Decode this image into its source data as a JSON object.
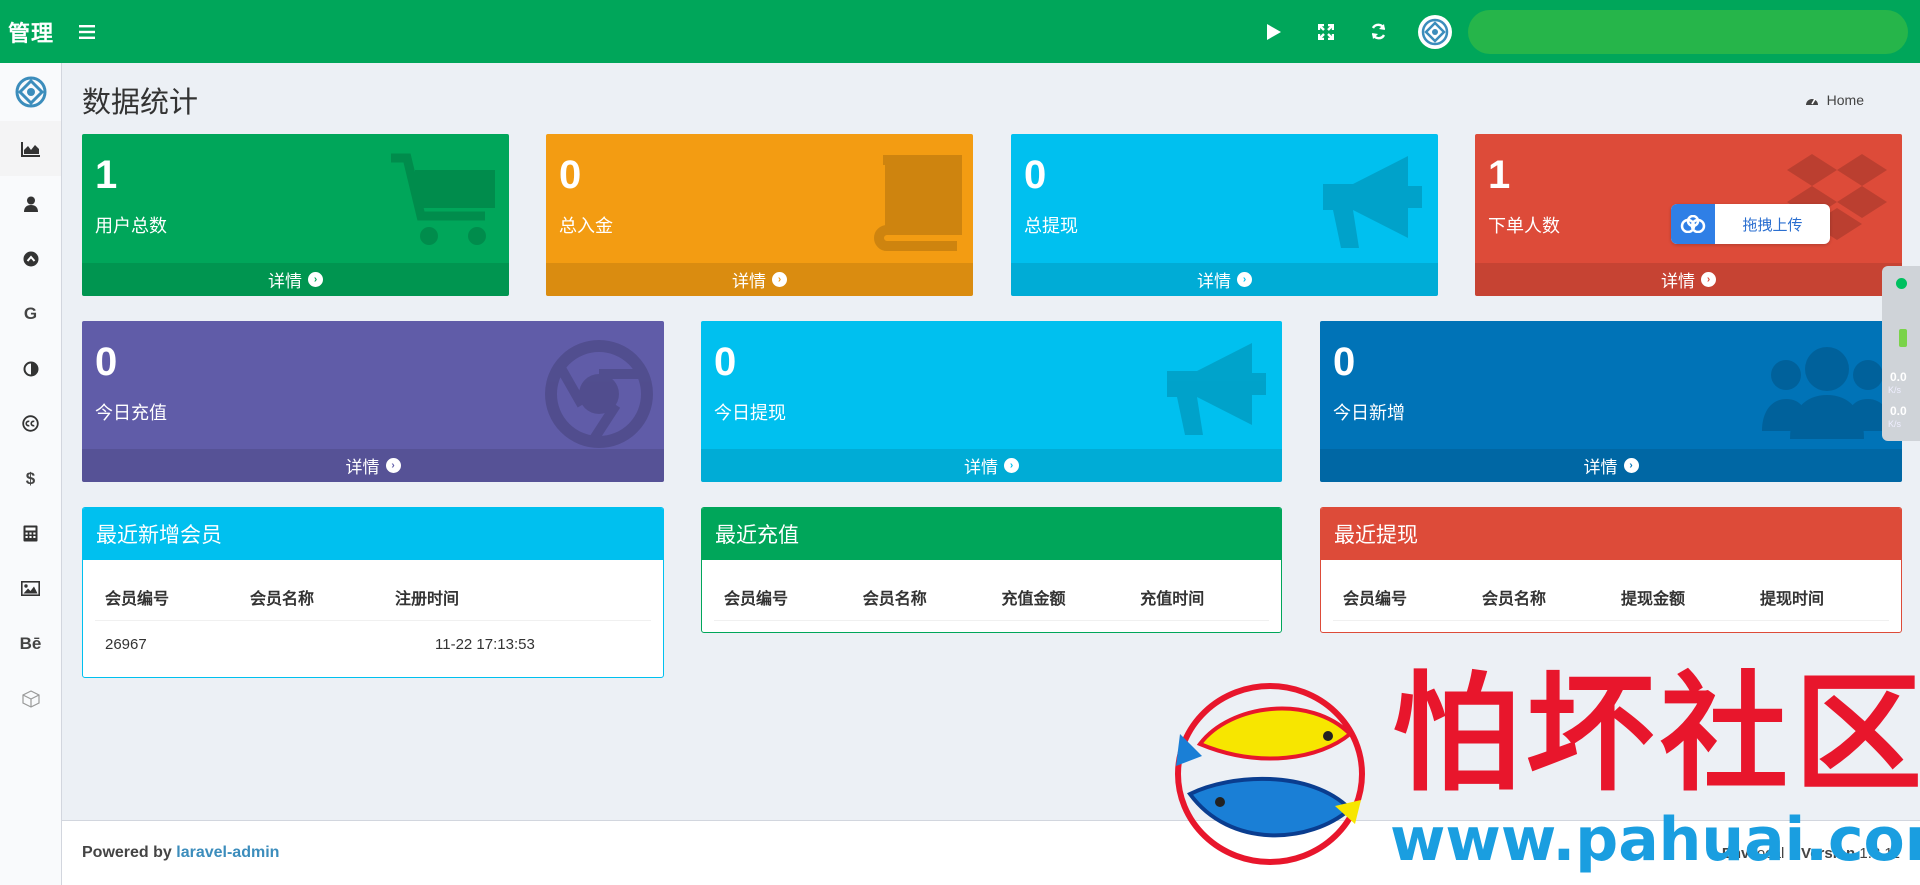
{
  "header": {
    "brand": "管理",
    "menu_icon": "bars-icon",
    "actions": [
      "play-icon",
      "expand-icon",
      "refresh-icon"
    ],
    "accent": "#00a65a"
  },
  "sidebar": {
    "items": [
      {
        "icon": "area-chart-icon",
        "label": ""
      },
      {
        "icon": "user-icon",
        "label": ""
      },
      {
        "icon": "chevron-up-circle-icon",
        "label": ""
      },
      {
        "icon": "google-icon",
        "label": "G"
      },
      {
        "icon": "adjust-icon",
        "label": ""
      },
      {
        "icon": "creative-commons-icon",
        "label": ""
      },
      {
        "icon": "dollar-icon",
        "label": "$"
      },
      {
        "icon": "calculator-icon",
        "label": ""
      },
      {
        "icon": "image-icon",
        "label": ""
      },
      {
        "icon": "behance-icon",
        "label": "Bē"
      },
      {
        "icon": "cube-icon",
        "label": ""
      }
    ]
  },
  "page": {
    "title": "数据统计",
    "breadcrumb": "Home"
  },
  "stats": [
    {
      "value": "1",
      "label": "用户总数",
      "link": "详情",
      "color": "#00a65a",
      "icon": "shopping-cart-icon"
    },
    {
      "value": "0",
      "label": "总入金",
      "link": "详情",
      "color": "#f39c12",
      "icon": "book-icon"
    },
    {
      "value": "0",
      "label": "总提现",
      "link": "详情",
      "color": "#00c0ef",
      "icon": "bullhorn-icon"
    },
    {
      "value": "1",
      "label": "下单人数",
      "link": "详情",
      "color": "#dd4b39",
      "icon": "dropbox-icon"
    },
    {
      "value": "0",
      "label": "今日充值",
      "link": "详情",
      "color": "#605ca8",
      "icon": "chrome-icon"
    },
    {
      "value": "0",
      "label": "今日提现",
      "link": "详情",
      "color": "#00c0ef",
      "icon": "bullhorn-icon"
    },
    {
      "value": "0",
      "label": "今日新增",
      "link": "详情",
      "color": "#0073b7",
      "icon": "users-icon"
    }
  ],
  "upload_widget": {
    "label": "拖拽上传"
  },
  "speed_widget": {
    "up": "0.0",
    "up_unit": "K/s",
    "down": "0.0",
    "down_unit": "K/s"
  },
  "panels": {
    "members": {
      "title": "最近新增会员",
      "color": "#00c0ef",
      "columns": [
        "会员编号",
        "会员名称",
        "注册时间"
      ],
      "rows": [
        [
          "26967",
          "",
          "11-22 17:13:53"
        ]
      ]
    },
    "recharge": {
      "title": "最近充值",
      "color": "#00a65a",
      "columns": [
        "会员编号",
        "会员名称",
        "充值金额",
        "充值时间"
      ],
      "rows": []
    },
    "withdraw": {
      "title": "最近提现",
      "color": "#dd4b39",
      "columns": [
        "会员编号",
        "会员名称",
        "提现金额",
        "提现时间"
      ],
      "rows": []
    }
  },
  "footer": {
    "powered_by": "Powered by",
    "link": "laravel-admin",
    "env_label": "Env",
    "env": "local",
    "version_label": "Version",
    "version": "1.8.11"
  },
  "watermark": {
    "title": "怕坏社区",
    "url": "www.pahuai.com"
  }
}
